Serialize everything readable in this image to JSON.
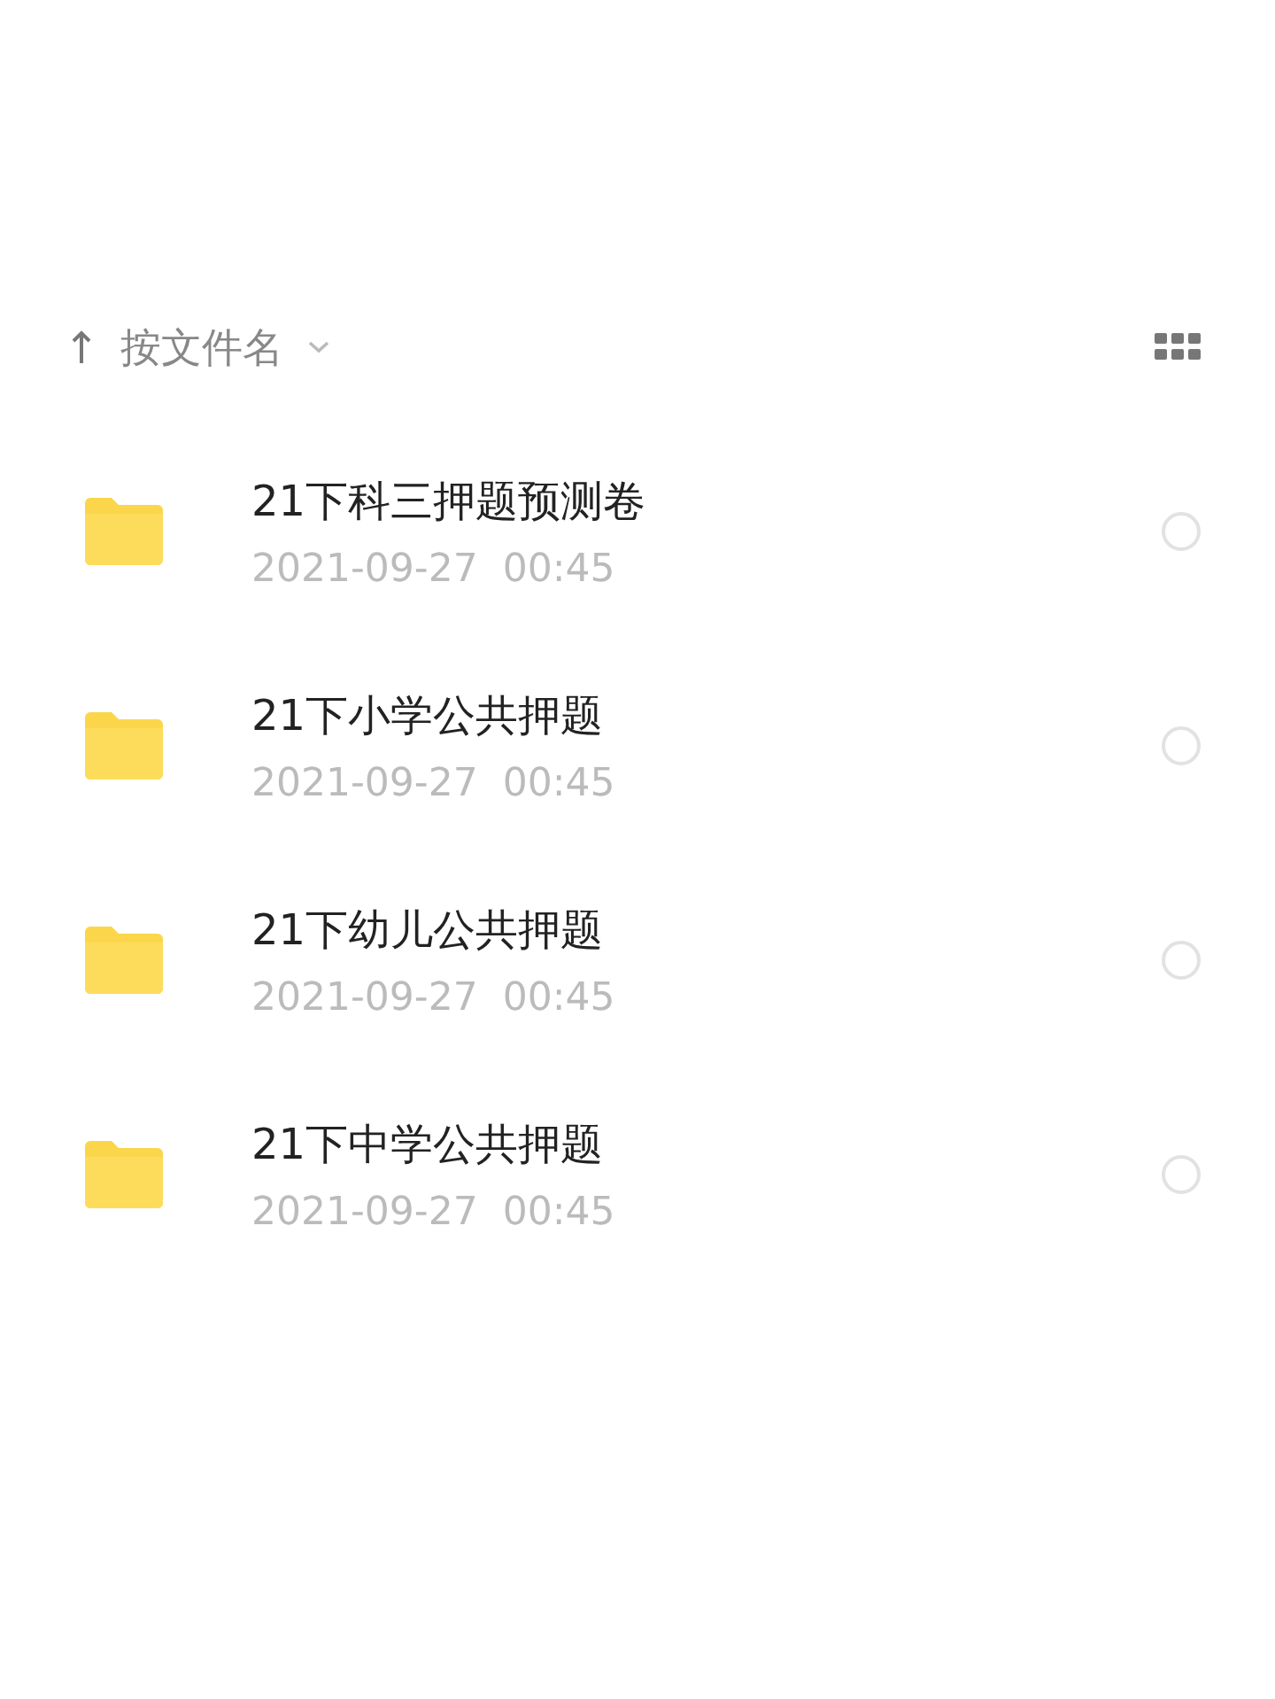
{
  "sort_bar": {
    "label": "按文件名"
  },
  "files": [
    {
      "name": "21下科三押题预测卷",
      "date": "2021-09-27  00:45",
      "selected": false
    },
    {
      "name": "21下小学公共押题",
      "date": "2021-09-27  00:45",
      "selected": false
    },
    {
      "name": "21下幼儿公共押题",
      "date": "2021-09-27  00:45",
      "selected": false
    },
    {
      "name": "21下中学公共押题",
      "date": "2021-09-27  00:45",
      "selected": false
    }
  ]
}
